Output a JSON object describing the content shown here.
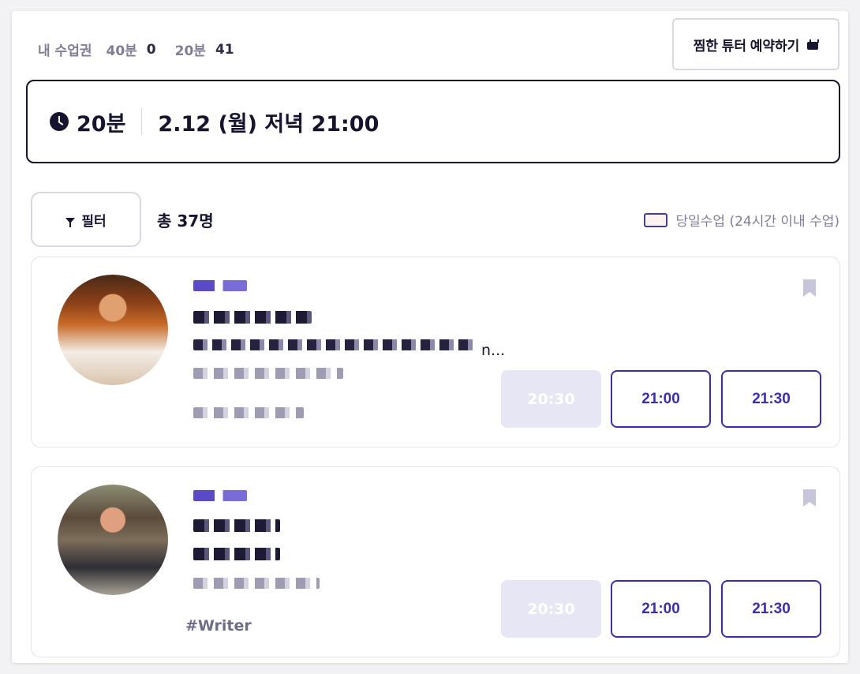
{
  "credits": {
    "title": "내 수업권",
    "items": [
      {
        "label": "40분",
        "value": "0"
      },
      {
        "label": "20분",
        "value": "41"
      }
    ]
  },
  "favorite_button": {
    "label": "찜한 튜터 예약하기",
    "icon": "calendar-icon"
  },
  "selected": {
    "duration": "20분",
    "datetime": "2.12 (월) 저녁 21:00",
    "icon": "clock-icon"
  },
  "filter": {
    "label": "필터",
    "icon": "filter-icon"
  },
  "total": "총 37명",
  "legend": {
    "label": "당일수업 (24시간 이내 수업)"
  },
  "tutors": [
    {
      "intro_fragment": "n...",
      "hashtag": "",
      "slots": [
        {
          "time": "20:30",
          "available": false
        },
        {
          "time": "21:00",
          "available": true
        },
        {
          "time": "21:30",
          "available": true
        }
      ]
    },
    {
      "intro_fragment": "",
      "hashtag": "#Writer",
      "slots": [
        {
          "time": "20:30",
          "available": false
        },
        {
          "time": "21:00",
          "available": true
        },
        {
          "time": "21:30",
          "available": true
        }
      ]
    }
  ],
  "colors": {
    "accent": "#3b2fa8",
    "ink": "#16142e",
    "muted": "#7f7e96",
    "disabled_slot": "#e6e6f4"
  }
}
